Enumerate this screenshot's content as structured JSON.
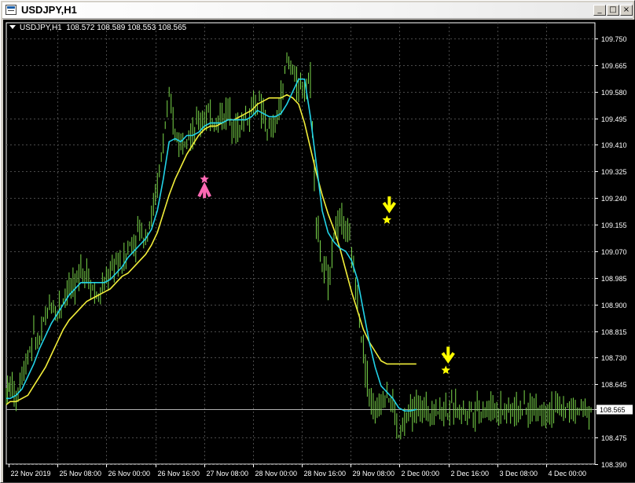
{
  "window": {
    "title": "USDJPY,H1",
    "buttons": [
      "_",
      "□",
      "×"
    ]
  },
  "chart_header": {
    "symbol": "USDJPY,H1",
    "ohlc": "108.572 108.589 108.553 108.565"
  },
  "colors": {
    "background": "#000000",
    "grid": "#4a4a4a",
    "candles": "#7bd84a",
    "ma_fast": "#22d3e8",
    "ma_slow": "#f2ee3a",
    "buy_signal": "#ff69b4",
    "sell_signal": "#ffff00",
    "axis_text": "#ffffff",
    "current_price_line": "#b0b0b0"
  },
  "chart_data": {
    "type": "line",
    "title": "USDJPY,H1",
    "ylim": [
      108.39,
      109.8
    ],
    "y_ticks": [
      "109.750",
      "109.665",
      "109.580",
      "109.495",
      "109.410",
      "109.325",
      "109.240",
      "109.155",
      "109.070",
      "108.985",
      "108.900",
      "108.815",
      "108.730",
      "108.645",
      "108.565",
      "108.475",
      "108.390"
    ],
    "current_price": "108.565",
    "x_ticks": [
      "22 Nov 2019",
      "25 Nov 08:00",
      "26 Nov 00:00",
      "26 Nov 16:00",
      "27 Nov 08:00",
      "28 Nov 00:00",
      "28 Nov 16:00",
      "29 Nov 08:00",
      "2 Dec 00:00",
      "2 Dec 16:00",
      "3 Dec 08:00",
      "4 Dec 00:00"
    ],
    "grid": true,
    "x": [
      0,
      2,
      5,
      8,
      11,
      14,
      17,
      20,
      23,
      26,
      29,
      32,
      35,
      38,
      41,
      44,
      47,
      50,
      53,
      56,
      59,
      62,
      65,
      68,
      71,
      74,
      77,
      80,
      83,
      86,
      89,
      92,
      95,
      98,
      101,
      104,
      107,
      110,
      113,
      116,
      119,
      122,
      125,
      128,
      131,
      134,
      137,
      140,
      143,
      146,
      149,
      152,
      155,
      158,
      161,
      164,
      167,
      170,
      173,
      176,
      179,
      182,
      185,
      188,
      191,
      194,
      197,
      200,
      203,
      206,
      209,
      212,
      215,
      218,
      221,
      224,
      227,
      230,
      233,
      236,
      239,
      242,
      245,
      248,
      251,
      254,
      257,
      260,
      263,
      266,
      269,
      272,
      275,
      278,
      281,
      284,
      287,
      290,
      293,
      296,
      299
    ],
    "close": [
      108.62,
      108.64,
      108.6,
      108.68,
      108.74,
      108.8,
      108.78,
      108.86,
      108.9,
      108.88,
      108.92,
      108.96,
      108.95,
      109.02,
      109.0,
      108.95,
      108.92,
      108.96,
      109.0,
      109.04,
      109.02,
      109.08,
      109.1,
      109.14,
      109.12,
      109.18,
      109.28,
      109.42,
      109.55,
      109.45,
      109.42,
      109.46,
      109.44,
      109.48,
      109.5,
      109.5,
      109.48,
      109.5,
      109.52,
      109.48,
      109.46,
      109.5,
      109.52,
      109.55,
      109.5,
      109.45,
      109.47,
      109.55,
      109.68,
      109.66,
      109.58,
      109.6,
      109.62,
      109.18,
      109.02,
      108.98,
      109.12,
      109.17,
      109.15,
      109.06,
      108.92,
      108.75,
      108.62,
      108.54,
      108.6,
      108.62,
      108.58,
      108.48,
      108.52,
      108.56,
      108.565,
      108.565,
      108.565,
      108.565,
      108.565,
      108.565,
      108.565,
      108.565,
      108.565,
      108.565,
      108.565,
      108.565,
      108.565,
      108.565,
      108.565,
      108.565,
      108.565,
      108.565,
      108.565,
      108.565,
      108.565,
      108.565,
      108.565,
      108.565,
      108.565,
      108.565,
      108.565,
      108.565,
      108.565,
      108.565,
      108.565
    ],
    "series": [
      {
        "values": [
          108.6,
          108.6,
          108.61,
          108.63,
          108.67,
          108.71,
          108.76,
          108.8,
          108.84,
          108.87,
          108.9,
          108.93,
          108.95,
          108.97,
          108.97,
          108.97,
          108.97,
          108.97,
          108.98,
          109.0,
          109.02,
          109.05,
          109.07,
          109.09,
          109.11,
          109.14,
          109.2,
          109.3,
          109.42,
          109.43,
          109.42,
          109.44,
          109.44,
          109.45,
          109.47,
          109.48,
          109.48,
          109.48,
          109.49,
          109.49,
          109.49,
          109.49,
          109.5,
          109.52,
          109.51,
          109.5,
          109.5,
          109.51,
          109.54,
          109.58,
          109.62,
          109.62,
          109.5,
          109.35,
          109.2,
          109.13,
          109.1,
          109.08,
          109.07,
          109.04,
          108.98,
          108.88,
          108.78,
          108.7,
          108.64,
          108.62,
          108.6,
          108.57,
          108.56,
          108.56,
          108.565
        ]
      },
      {
        "values": [
          108.58,
          108.59,
          108.59,
          108.6,
          108.61,
          108.64,
          108.67,
          108.7,
          108.74,
          108.78,
          108.82,
          108.85,
          108.87,
          108.89,
          108.91,
          108.92,
          108.93,
          108.94,
          108.95,
          108.97,
          108.99,
          109.0,
          109.02,
          109.04,
          109.06,
          109.09,
          109.13,
          109.19,
          109.25,
          109.3,
          109.34,
          109.38,
          109.41,
          109.44,
          109.46,
          109.47,
          109.47,
          109.48,
          109.49,
          109.49,
          109.5,
          109.51,
          109.52,
          109.54,
          109.55,
          109.56,
          109.56,
          109.56,
          109.57,
          109.56,
          109.54,
          109.48,
          109.4,
          109.32,
          109.25,
          109.19,
          109.14,
          109.08,
          109.01,
          108.94,
          108.88,
          108.82,
          108.78,
          108.75,
          108.72,
          108.71,
          108.71,
          108.71,
          108.71,
          108.71,
          108.71
        ]
      }
    ],
    "annotations": [
      {
        "type": "buy",
        "x": 101,
        "y": 109.28
      },
      {
        "type": "sell",
        "x": 194,
        "y": 109.17
      },
      {
        "type": "sell",
        "x": 224,
        "y": 108.69
      }
    ]
  }
}
